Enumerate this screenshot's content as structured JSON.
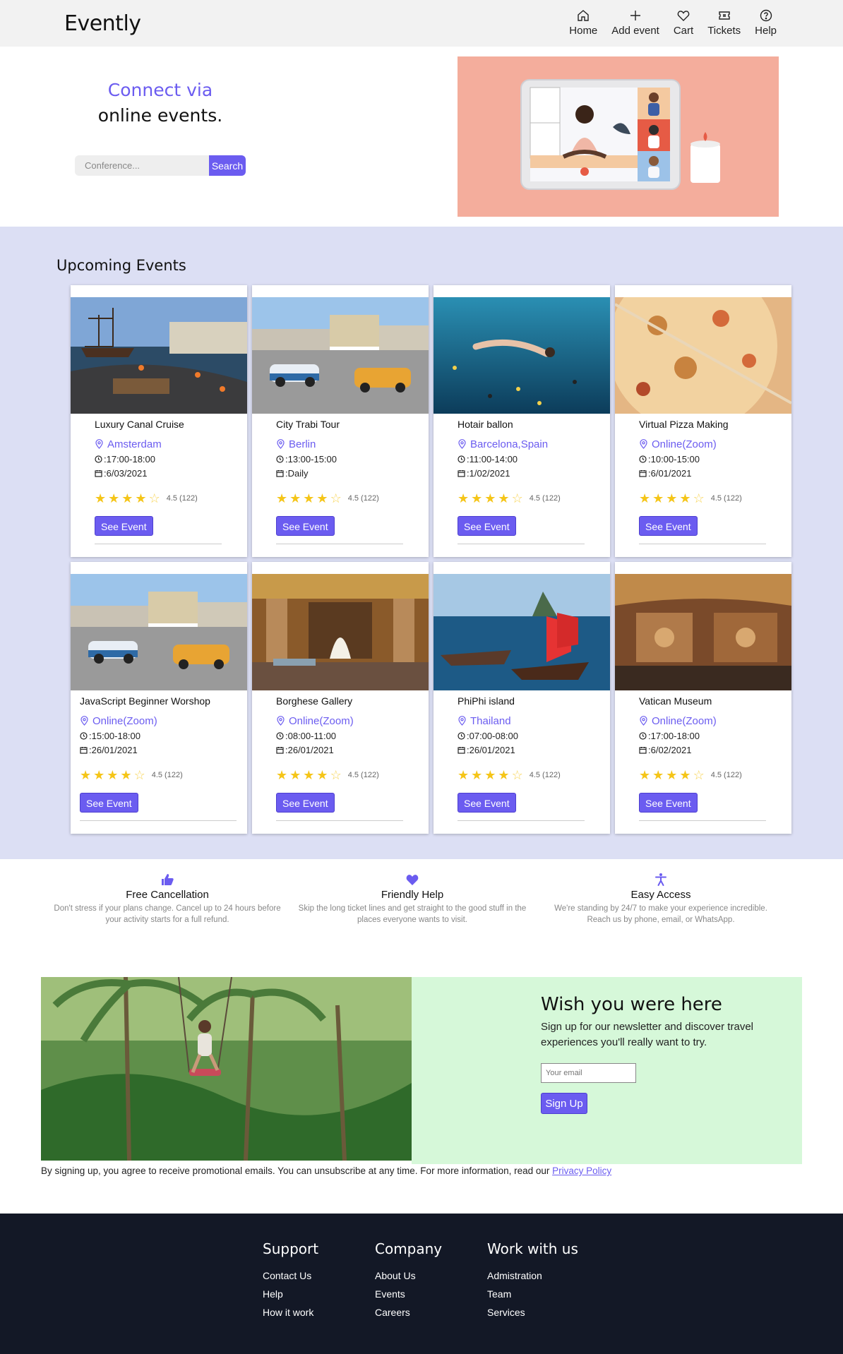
{
  "header": {
    "logo": "Evently",
    "nav": [
      {
        "label": "Home",
        "icon": "home-icon"
      },
      {
        "label": "Add event",
        "icon": "plus-icon"
      },
      {
        "label": "Cart",
        "icon": "heart-icon"
      },
      {
        "label": "Tickets",
        "icon": "ticket-icon"
      },
      {
        "label": "Help",
        "icon": "help-icon"
      }
    ]
  },
  "hero": {
    "title_accent": "Connect via",
    "title": "online events.",
    "search_placeholder": "Conference...",
    "search_button": "Search"
  },
  "events": {
    "title": "Upcoming Events",
    "see_event_label": "See Event",
    "cards": [
      {
        "title": "Luxury Canal Cruise",
        "location": "Amsterdam",
        "time": ":17:00-18:00",
        "date": ":6/03/2021",
        "rating": "4.5 (122)"
      },
      {
        "title": "City Trabi Tour",
        "location": "Berlin",
        "time": ":13:00-15:00",
        "date": ":Daily",
        "rating": "4.5 (122)"
      },
      {
        "title": "Hotair ballon",
        "location": "Barcelona,Spain",
        "time": ":11:00-14:00",
        "date": ":1/02/2021",
        "rating": "4.5 (122)"
      },
      {
        "title": "Virtual Pizza Making",
        "location": "Online(Zoom)",
        "time": ":10:00-15:00",
        "date": ":6/01/2021",
        "rating": "4.5 (122)"
      },
      {
        "title": "JavaScript Beginner Worshop",
        "location": "Online(Zoom)",
        "time": ":15:00-18:00",
        "date": ":26/01/2021",
        "rating": "4.5 (122)"
      },
      {
        "title": "Borghese Gallery",
        "location": "Online(Zoom)",
        "time": ":08:00-11:00",
        "date": ":26/01/2021",
        "rating": "4.5 (122)"
      },
      {
        "title": "PhiPhi island",
        "location": "Thailand",
        "time": ":07:00-08:00",
        "date": ":26/01/2021",
        "rating": "4.5 (122)"
      },
      {
        "title": "Vatican Museum",
        "location": "Online(Zoom)",
        "time": ":17:00-18:00",
        "date": ":6/02/2021",
        "rating": "4.5 (122)"
      }
    ]
  },
  "features": [
    {
      "title": "Free Cancellation",
      "text": "Don't stress if your plans change. Cancel up to 24 hours before your activity starts for a full refund.",
      "icon": "thumbs-up-icon"
    },
    {
      "title": "Friendly Help",
      "text": "Skip the long ticket lines and get straight to the good stuff in the places everyone wants to visit.",
      "icon": "heart-icon"
    },
    {
      "title": "Easy Access",
      "text": "We're standing by 24/7 to make your experience incredible. Reach us by phone, email, or WhatsApp.",
      "icon": "accessibility-icon"
    }
  ],
  "newsletter": {
    "title": "Wish you were here",
    "text": "Sign up for our newsletter and discover travel experiences you'll really want to try.",
    "email_placeholder": "Your email",
    "button": "Sign Up",
    "disclaimer": "By signing up, you agree to receive promotional emails. You can unsubscribe at any time. For more information, read our ",
    "privacy_link": "Privacy Policy"
  },
  "footer": {
    "columns": [
      {
        "title": "Support",
        "links": [
          "Contact Us",
          "Help",
          "How it work"
        ]
      },
      {
        "title": "Company",
        "links": [
          "About Us",
          "Events",
          "Careers"
        ]
      },
      {
        "title": "Work with us",
        "links": [
          "Admistration",
          "Team",
          "Services"
        ]
      }
    ]
  },
  "colors": {
    "accent": "#6b5cf0",
    "events_bg": "#dcdff4",
    "newsletter_bg": "#d6f8d9",
    "footer_bg": "#131826",
    "hero_illus_bg": "#f4ad9c"
  }
}
